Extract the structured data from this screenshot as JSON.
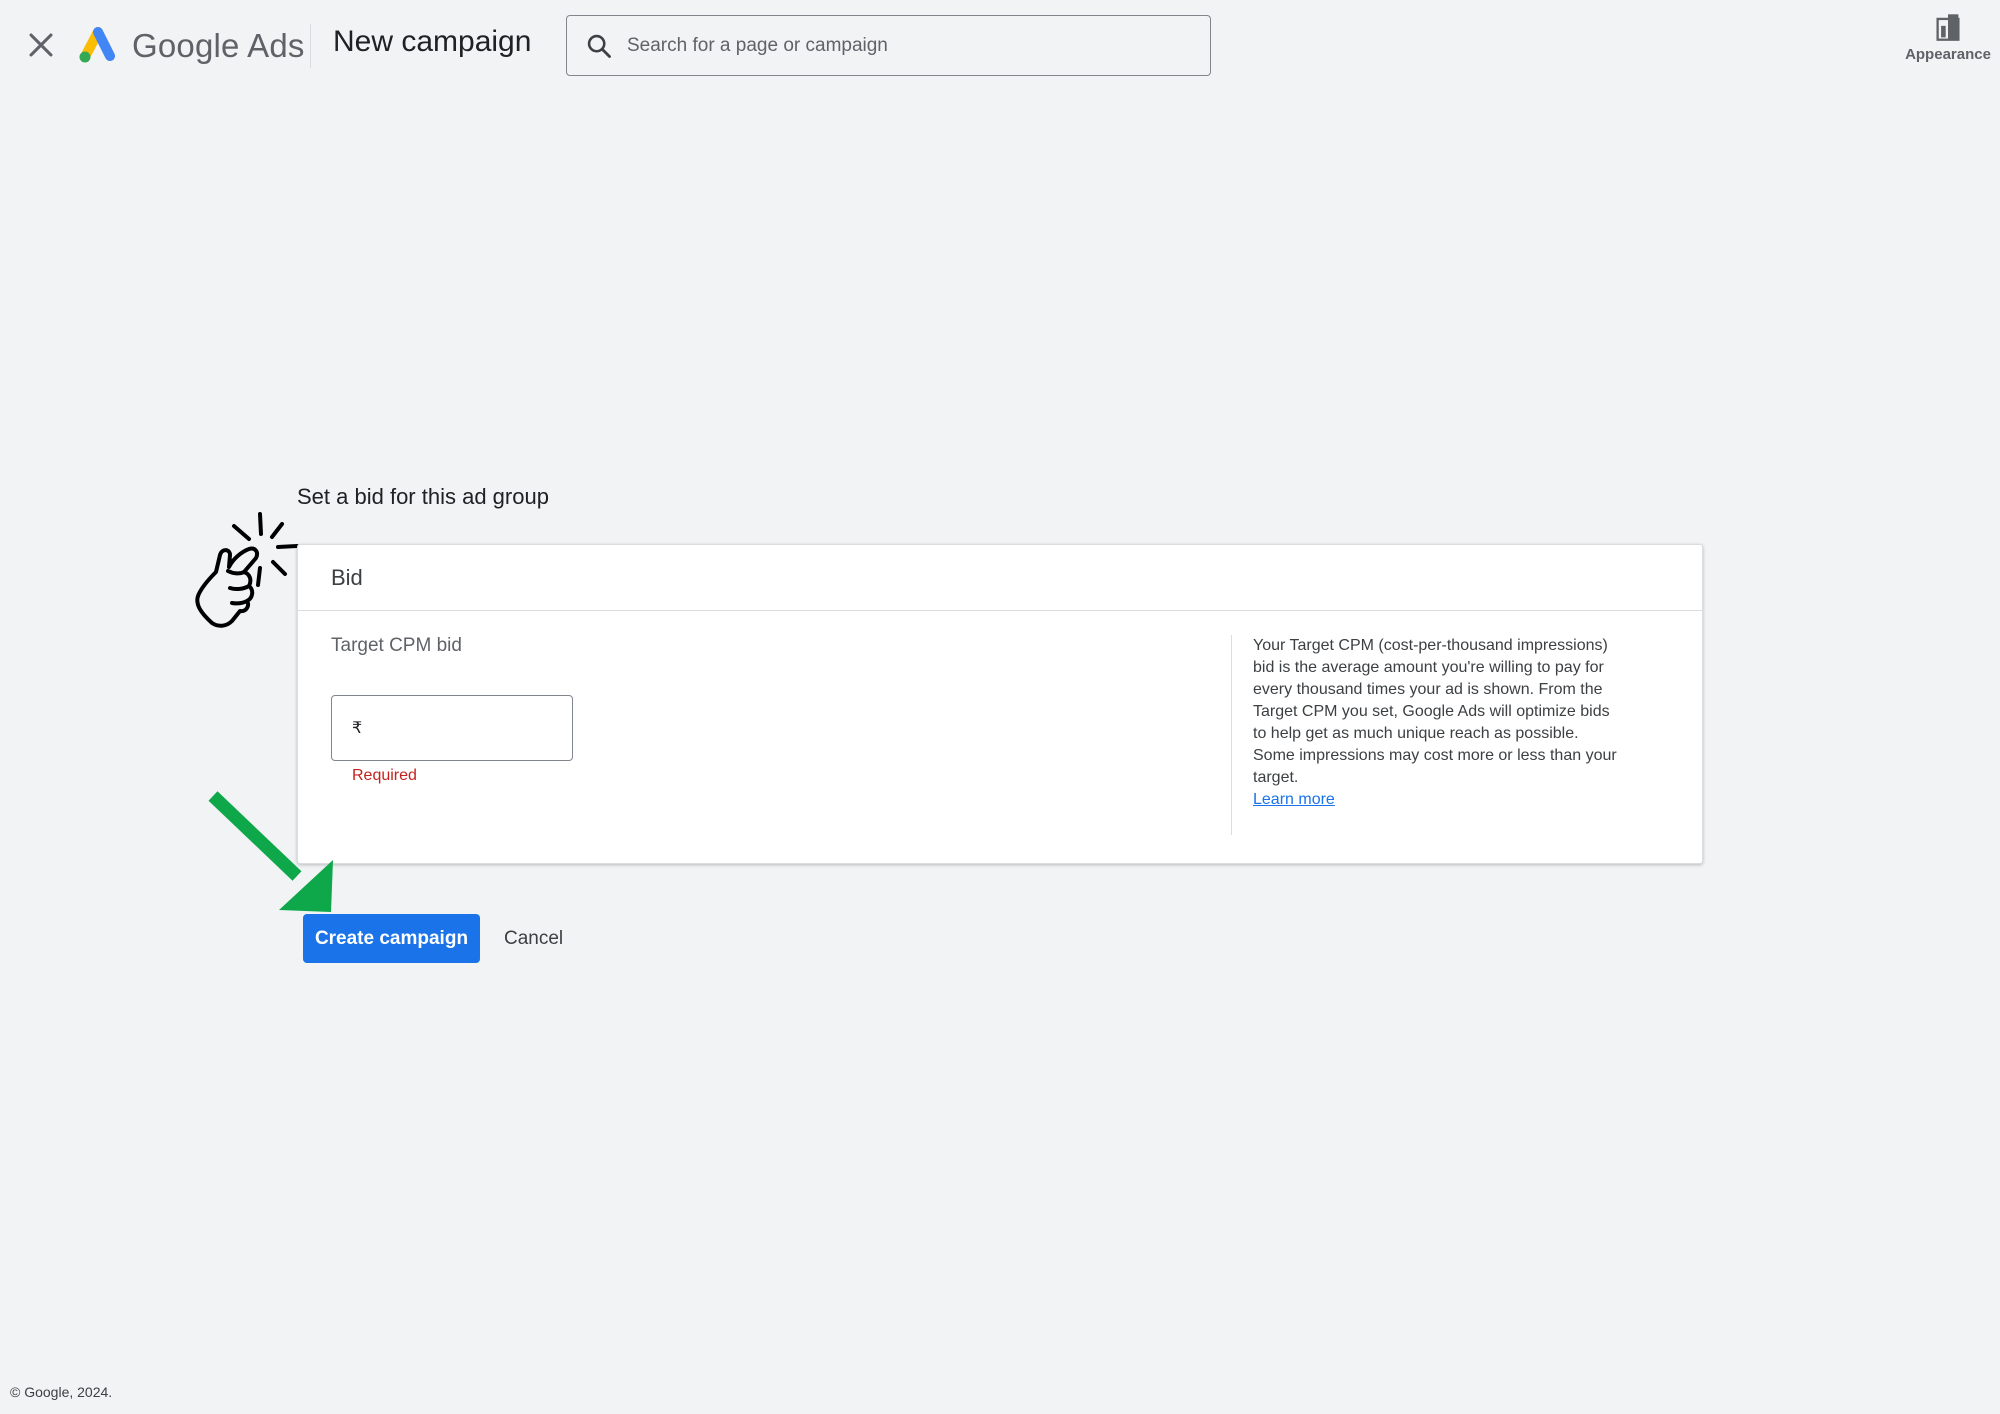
{
  "header": {
    "brand": "Google Ads",
    "title": "New campaign",
    "search_placeholder": "Search for a page or campaign",
    "appearance_label": "Appearance",
    "icons": {
      "close": "close-icon",
      "logo": "google-ads-logo",
      "search": "search-icon",
      "appearance": "appearance-icon"
    }
  },
  "section": {
    "heading": "Set a bid for this ad group"
  },
  "bid_card": {
    "title": "Bid",
    "field_label": "Target CPM bid",
    "currency_symbol": "₹",
    "value": "",
    "error": "Required",
    "help_text": "Your Target CPM (cost-per-thousand impressions) bid is the average amount you're willing to pay for every thousand times your ad is shown. From the Target CPM you set, Google Ads will optimize bids to help get as much unique reach as possible. Some impressions may cost more or less than your target.",
    "help_link": "Learn more"
  },
  "actions": {
    "create_label": "Create campaign",
    "cancel_label": "Cancel"
  },
  "annotations": {
    "hand": "snap-hand-icon",
    "arrow": "arrow-icon",
    "arrow_color": "#0ea84a"
  },
  "footer": {
    "copyright": "© Google, 2024."
  },
  "colors": {
    "primary": "#1a73e8",
    "error": "#c5221f",
    "background": "#f1f3f4"
  }
}
